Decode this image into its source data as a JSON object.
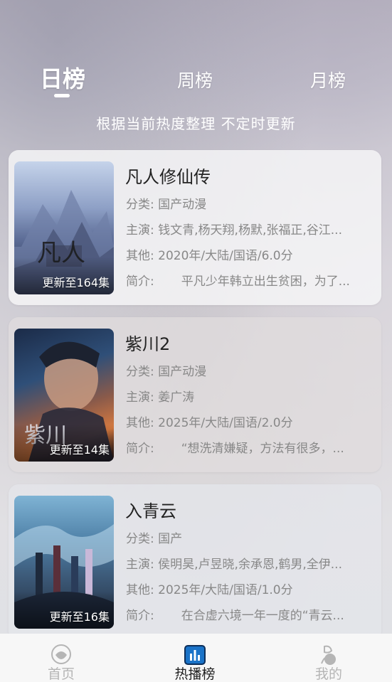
{
  "tabs": {
    "day": "日榜",
    "week": "周榜",
    "month": "月榜"
  },
  "subtitle": "根据当前热度整理 不定时更新",
  "items": [
    {
      "title": "凡人修仙传",
      "episode": "更新至164集",
      "category_label": "分类:",
      "category": "国产动漫",
      "cast_label": "主演:",
      "cast": "钱文青,杨天翔,杨默,张福正,谷江...",
      "other_label": "其他:",
      "other": "2020年/大陆/国语/6.0分",
      "intro_label": "简介:",
      "intro": "平凡少年韩立出生贫困，为了..."
    },
    {
      "title": "紫川2",
      "episode": "更新至14集",
      "category_label": "分类:",
      "category": "国产动漫",
      "cast_label": "主演:",
      "cast": "姜广涛",
      "other_label": "其他:",
      "other": "2025年/大陆/国语/2.0分",
      "intro_label": "简介:",
      "intro": "“想洗清嫌疑，方法有很多，..."
    },
    {
      "title": "入青云",
      "episode": "更新至16集",
      "category_label": "分类:",
      "category": "国产",
      "cast_label": "主演:",
      "cast": "侯明昊,卢昱晓,余承恩,鹤男,全伊...",
      "other_label": "其他:",
      "other": "2025年/大陆/国语/1.0分",
      "intro_label": "简介:",
      "intro": "在合虚六境一年一度的“青云..."
    }
  ],
  "nav": {
    "home": "首页",
    "rank": "热播榜",
    "mine": "我的"
  },
  "colors": {
    "active_tab": "#ffffff",
    "nav_active": "#222222",
    "nav_inactive": "#b5b5b5",
    "rank_icon": "#1a73c8"
  }
}
